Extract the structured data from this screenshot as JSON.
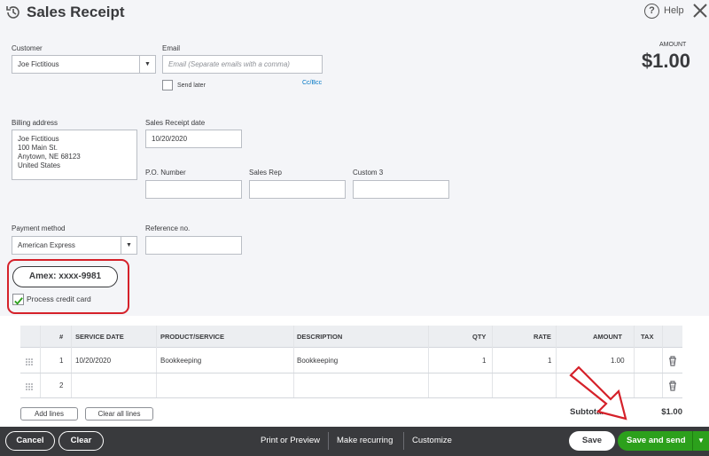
{
  "header": {
    "title": "Sales Receipt",
    "help_label": "Help",
    "icons": {
      "history": "history-icon",
      "help": "help-icon",
      "close": "close-icon"
    }
  },
  "form": {
    "customer": {
      "label": "Customer",
      "value": "Joe Fictitious"
    },
    "email": {
      "label": "Email",
      "placeholder": "Email (Separate emails with a comma)",
      "send_later": "Send later",
      "cc_bcc": "Cc/Bcc"
    },
    "amount": {
      "label": "AMOUNT",
      "value": "$1.00"
    },
    "billing_address": {
      "label": "Billing address",
      "lines": [
        "Joe Fictitious",
        "100 Main St.",
        "Anytown, NE  68123",
        "United States"
      ]
    },
    "receipt_date": {
      "label": "Sales Receipt date",
      "value": "10/20/2020"
    },
    "po_number": {
      "label": "P.O. Number",
      "value": ""
    },
    "sales_rep": {
      "label": "Sales Rep",
      "value": ""
    },
    "custom3": {
      "label": "Custom 3",
      "value": ""
    },
    "payment_method": {
      "label": "Payment method",
      "value": "American Express"
    },
    "reference_no": {
      "label": "Reference no.",
      "value": ""
    },
    "card_pill": "Amex: xxxx-9981",
    "process_card": {
      "label": "Process credit card",
      "checked": true
    }
  },
  "table": {
    "headers": [
      "#",
      "SERVICE DATE",
      "PRODUCT/SERVICE",
      "DESCRIPTION",
      "QTY",
      "RATE",
      "AMOUNT",
      "TAX"
    ],
    "rows": [
      {
        "num": "1",
        "date": "10/20/2020",
        "product": "Bookkeeping",
        "description": "Bookkeeping",
        "qty": "1",
        "rate": "1",
        "amount": "1.00"
      },
      {
        "num": "2",
        "date": "",
        "product": "",
        "description": "",
        "qty": "",
        "rate": "",
        "amount": ""
      }
    ],
    "add_lines": "Add lines",
    "clear_lines": "Clear all lines",
    "subtotal_label": "Subtotal",
    "subtotal_value": "$1.00"
  },
  "footer": {
    "cancel": "Cancel",
    "clear": "Clear",
    "print_preview": "Print or Preview",
    "make_recurring": "Make recurring",
    "customize": "Customize",
    "save": "Save",
    "save_send": "Save and send"
  },
  "colors": {
    "accent_green": "#2ca01c",
    "annotation_red": "#d5212a",
    "footer_bg": "#393a3d"
  }
}
